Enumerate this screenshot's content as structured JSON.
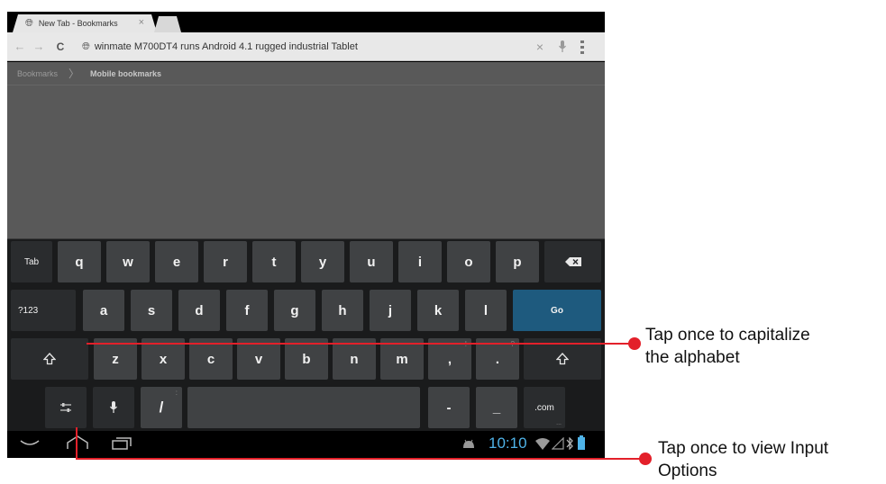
{
  "browser": {
    "tab_title": "New Tab - Bookmarks",
    "tab_close": "×",
    "url": "winmate M700DT4 runs Android 4.1 rugged industrial Tablet",
    "clear": "×",
    "back": "←",
    "forward": "→",
    "reload": "C"
  },
  "bookmarks": {
    "breadcrumb_root": "Bookmarks",
    "breadcrumb_separator": "〉",
    "breadcrumb_current": "Mobile bookmarks"
  },
  "keyboard": {
    "row1": [
      "q",
      "w",
      "e",
      "r",
      "t",
      "y",
      "u",
      "i",
      "o",
      "p"
    ],
    "row2": [
      "a",
      "s",
      "d",
      "f",
      "g",
      "h",
      "j",
      "k",
      "l"
    ],
    "row3": [
      "z",
      "x",
      "c",
      "v",
      "b",
      "n",
      "m",
      ",",
      "."
    ],
    "tab_label": "Tab",
    "sym_label": "?123",
    "go_label": "Go",
    "slash_label": "/",
    "slash_hint": ":",
    "dash_label": "-",
    "underscore_label": "_",
    "dotcom_label": ".com",
    "dotcom_sub": "...",
    "comma_hint": "!",
    "period_hint": "?",
    "accent_color": "#1e5a7e"
  },
  "status": {
    "clock": "10:10"
  },
  "annotations": {
    "shift_callout": [
      "Tap once to capitalize",
      "the alphabet"
    ],
    "input_options_callout": [
      "Tap once to view Input",
      "Options"
    ],
    "line_color": "#e3202a"
  }
}
